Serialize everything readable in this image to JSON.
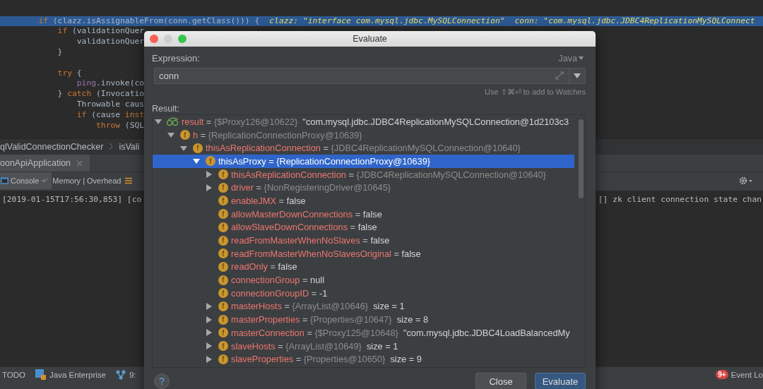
{
  "editor": {
    "lines": [
      {
        "kind": "code",
        "highlighted": true,
        "tokens": [
          {
            "text": "        if",
            "kind": "keyword"
          },
          {
            "text": " (clazz.isAssignableFrom(conn.getClass())) {",
            "kind": "plain"
          }
        ],
        "inline_values": [
          "clazz: \"interface com.mysql.jdbc.MySQLConnection\"",
          "conn: \"com.mysql.jdbc.JDBC4ReplicationMySQLConnect"
        ]
      },
      {
        "kind": "code",
        "highlighted": false,
        "tokens": [
          {
            "text": "            if",
            "kind": "keyword"
          },
          {
            "text": " (validationQuer",
            "kind": "plain"
          }
        ]
      },
      {
        "kind": "code",
        "highlighted": false,
        "tokens": [
          {
            "text": "                validationQuer",
            "kind": "plain"
          }
        ]
      },
      {
        "kind": "code",
        "highlighted": false,
        "tokens": [
          {
            "text": "            }",
            "kind": "plain"
          }
        ]
      },
      {
        "kind": "blank"
      },
      {
        "kind": "code",
        "highlighted": false,
        "tokens": [
          {
            "text": "            try",
            "kind": "keyword"
          },
          {
            "text": " {",
            "kind": "plain"
          }
        ]
      },
      {
        "kind": "code",
        "highlighted": false,
        "tokens": [
          {
            "text": "                ping",
            "kind": "field"
          },
          {
            "text": ".invoke(co",
            "kind": "plain"
          }
        ]
      },
      {
        "kind": "code",
        "highlighted": false,
        "tokens": [
          {
            "text": "            } ",
            "kind": "plain"
          },
          {
            "text": "catch",
            "kind": "keyword"
          },
          {
            "text": " (Invocatio",
            "kind": "plain"
          }
        ]
      },
      {
        "kind": "code",
        "highlighted": false,
        "tokens": [
          {
            "text": "                Throwable caus",
            "kind": "plain"
          }
        ]
      },
      {
        "kind": "code",
        "highlighted": false,
        "tokens": [
          {
            "text": "                if",
            "kind": "keyword"
          },
          {
            "text": " (cause ",
            "kind": "plain"
          },
          {
            "text": "inst",
            "kind": "keyword"
          }
        ]
      },
      {
        "kind": "code",
        "highlighted": false,
        "tokens": [
          {
            "text": "                    throw",
            "kind": "keyword"
          },
          {
            "text": " (SQL",
            "kind": "plain"
          }
        ]
      }
    ]
  },
  "breadcrumbs": [
    "qlValidConnectionChecker",
    "isVali"
  ],
  "run_tabs": [
    {
      "label": "oonApiApplication",
      "selected": true
    }
  ],
  "console_tabs": [
    {
      "label": "Console",
      "kind": "console",
      "selected": true
    },
    {
      "label": "Memory | Overhead",
      "kind": "plain",
      "selected": false
    }
  ],
  "console": {
    "left_line": "[2019-01-15T17:56:30,853] [co",
    "right_line": "[] zk client connection state chan"
  },
  "bottom_toolbar": {
    "items": [
      {
        "label": "TODO",
        "kind": "plain"
      },
      {
        "label": "Java Enterprise",
        "kind": "enterprise"
      },
      {
        "label": "9:",
        "kind": "vcs"
      }
    ],
    "event_badge": "9+",
    "event_label": "Event Lo"
  },
  "dialog": {
    "title": "Evaluate",
    "expression_label": "Expression:",
    "language": "Java",
    "expression": "conn",
    "hint": "Use ⇧⌘⏎ to add to Watches",
    "result_label": "Result:",
    "tree": [
      {
        "kind": "result",
        "name": "result",
        "sep": "=",
        "ref": "{$Proxy126@10622}",
        "value": "\"com.mysql.jdbc.JDBC4ReplicationMySQLConnection@1d2103c3",
        "expanded": true,
        "selected": false,
        "children": [
          {
            "kind": "field",
            "badge": "f",
            "name": "h",
            "sep": "=",
            "ref": "{ReplicationConnectionProxy@10639}",
            "expanded": true,
            "selected": false,
            "children": [
              {
                "kind": "field",
                "badge": "f",
                "name": "thisAsReplicationConnection",
                "sep": "=",
                "ref": "{JDBC4ReplicationMySQLConnection@10640}",
                "expanded": true,
                "selected": false,
                "children": [
                  {
                    "kind": "field",
                    "badge": "f",
                    "name": "thisAsProxy",
                    "sep": "=",
                    "value": "{ReplicationConnectionProxy@10639}",
                    "expanded": true,
                    "selected": true,
                    "children": [
                      {
                        "kind": "field",
                        "badge": "f",
                        "name": "thisAsReplicationConnection",
                        "sep": "=",
                        "ref": "{JDBC4ReplicationMySQLConnection@10640}",
                        "expanded": false,
                        "selected": false
                      },
                      {
                        "kind": "field",
                        "badge": "f",
                        "name": "driver",
                        "sep": "=",
                        "ref": "{NonRegisteringDriver@10645}",
                        "expanded": false,
                        "selected": false
                      },
                      {
                        "kind": "field",
                        "badge": "f",
                        "name": "enableJMX",
                        "sep": "=",
                        "value": "false",
                        "selected": false
                      },
                      {
                        "kind": "field",
                        "badge": "f",
                        "name": "allowMasterDownConnections",
                        "sep": "=",
                        "value": "false",
                        "selected": false
                      },
                      {
                        "kind": "field",
                        "badge": "f",
                        "name": "allowSlaveDownConnections",
                        "sep": "=",
                        "value": "false",
                        "selected": false
                      },
                      {
                        "kind": "field",
                        "badge": "f",
                        "name": "readFromMasterWhenNoSlaves",
                        "sep": "=",
                        "value": "false",
                        "selected": false
                      },
                      {
                        "kind": "field",
                        "badge": "f",
                        "name": "readFromMasterWhenNoSlavesOriginal",
                        "sep": "=",
                        "value": "false",
                        "selected": false
                      },
                      {
                        "kind": "field",
                        "badge": "f",
                        "name": "readOnly",
                        "sep": "=",
                        "value": "false",
                        "selected": false
                      },
                      {
                        "kind": "field",
                        "badge": "f",
                        "name": "connectionGroup",
                        "sep": "=",
                        "value": "null",
                        "selected": false
                      },
                      {
                        "kind": "field",
                        "badge": "f",
                        "name": "connectionGroupID",
                        "sep": "=",
                        "value": "-1",
                        "selected": false
                      },
                      {
                        "kind": "field",
                        "badge": "f",
                        "name": "masterHosts",
                        "sep": "=",
                        "ref": "{ArrayList@10646}",
                        "value": "size = 1",
                        "expanded": false,
                        "selected": false
                      },
                      {
                        "kind": "field",
                        "badge": "f",
                        "name": "masterProperties",
                        "sep": "=",
                        "ref": "{Properties@10647}",
                        "value": "size = 8",
                        "expanded": false,
                        "selected": false
                      },
                      {
                        "kind": "field",
                        "badge": "f",
                        "name": "masterConnection",
                        "sep": "=",
                        "ref": "{$Proxy125@10648}",
                        "value": "\"com.mysql.jdbc.JDBC4LoadBalancedMy",
                        "expanded": false,
                        "selected": false
                      },
                      {
                        "kind": "field",
                        "badge": "f",
                        "name": "slaveHosts",
                        "sep": "=",
                        "ref": "{ArrayList@10649}",
                        "value": "size = 1",
                        "expanded": false,
                        "selected": false
                      },
                      {
                        "kind": "field",
                        "badge": "f",
                        "name": "slaveProperties",
                        "sep": "=",
                        "ref": "{Properties@10650}",
                        "value": "size = 9",
                        "expanded": false,
                        "selected": false
                      }
                    ]
                  }
                ]
              }
            ]
          }
        ]
      }
    ],
    "help": "?",
    "buttons": [
      {
        "label": "Close",
        "kind": "secondary"
      },
      {
        "label": "Evaluate",
        "kind": "primary"
      }
    ]
  }
}
